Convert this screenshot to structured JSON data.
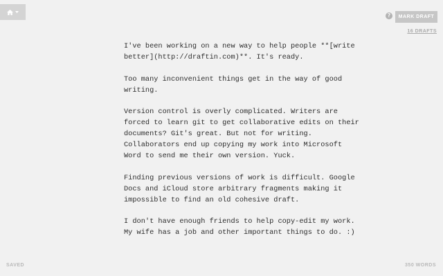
{
  "toolbar": {
    "home_icon": "home-icon",
    "menu_caret_icon": "caret-down-icon",
    "help_icon_glyph": "?",
    "mark_draft_label": "MARK DRAFT",
    "drafts_link_label": "16 DRAFTS"
  },
  "editor": {
    "paragraphs": [
      "I've been working on a new way to help people **[write better](http://draftin.com)**. It's ready.",
      "Too many inconvenient things get in the way of good writing.",
      "Version control is overly complicated. Writers are forced to learn git to get collaborative edits on their documents? Git's great. But not for writing. Collaborators end up copying my work into Microsoft Word to send me their own version. Yuck.",
      "Finding previous versions of work is difficult. Google Docs and iCloud store arbitrary fragments making it impossible to find an old cohesive draft.",
      "I don't have enough friends to help copy-edit my work. My wife has a job and other important things to do. :)"
    ]
  },
  "footer": {
    "status": "SAVED",
    "word_count": "350 WORDS"
  },
  "colors": {
    "background": "#f1f1f1",
    "menu_background": "#d4d4d4",
    "button_background": "#c6c6c6",
    "text": "#2d2d2d",
    "muted_text": "#aaaaaa"
  }
}
